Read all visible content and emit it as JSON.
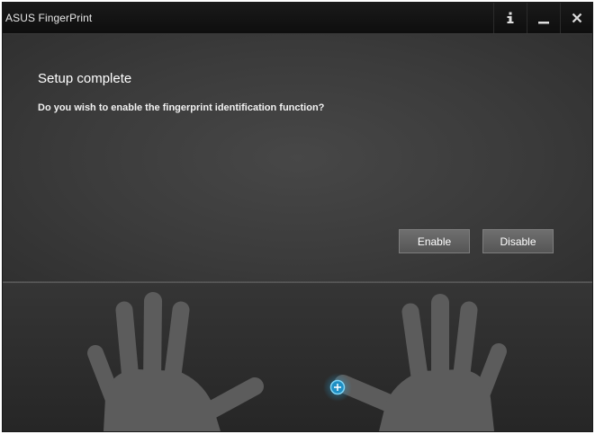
{
  "window": {
    "title": "ASUS FingerPrint"
  },
  "titlebar": {
    "info_icon": "info-icon",
    "minimize_icon": "minimize-icon",
    "close_icon": "close-icon"
  },
  "main": {
    "heading": "Setup complete",
    "question": "Do you wish to enable the fingerprint identification function?",
    "enable_label": "Enable",
    "disable_label": "Disable"
  },
  "hands": {
    "left_hand_icon": "left-hand-icon",
    "right_hand_icon": "right-hand-icon",
    "selector_icon": "plus-circle-icon"
  },
  "colors": {
    "background": "#2e2e2e",
    "titlebar": "#111111",
    "accent": "#29a9e0",
    "hand": "#5c5c5c"
  }
}
